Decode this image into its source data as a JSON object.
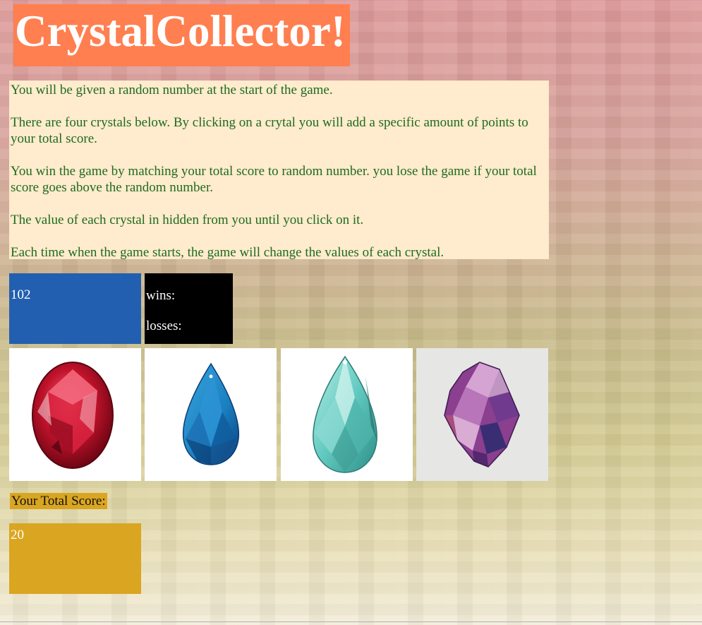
{
  "page": {
    "title": "CrystalCollector!"
  },
  "instructions": [
    "You will be given a random number at the start of the game.",
    "There are four crystals below. By clicking on a crytal you will add a specific amount of points to your total score.",
    "You win the game by matching your total score to random number. you lose the game if your total score goes above the random number.",
    "The value of each crystal in hidden from you until you click on it.",
    "Each time when the game starts, the game will change the values of each crystal."
  ],
  "game": {
    "target_number": "102",
    "wins_label": "wins:",
    "losses_label": "losses:",
    "total_score_label": "Your Total Score:",
    "total_score": "20"
  },
  "crystals": [
    {
      "name": "red-oval-gem-icon",
      "color": "#c0122b"
    },
    {
      "name": "blue-teardrop-crystal-icon",
      "color": "#1a7fc0"
    },
    {
      "name": "aqua-teardrop-crystal-icon",
      "color": "#62c9c0"
    },
    {
      "name": "purple-raw-crystal-icon",
      "color": "#8a3f8f"
    }
  ],
  "colors": {
    "title_bg": "#ff7f50",
    "instructions_bg": "#ffebcd",
    "instructions_text": "#1f6b1f",
    "target_bg": "#225fb0",
    "stats_bg": "#000000",
    "score_bg": "#daa520"
  }
}
